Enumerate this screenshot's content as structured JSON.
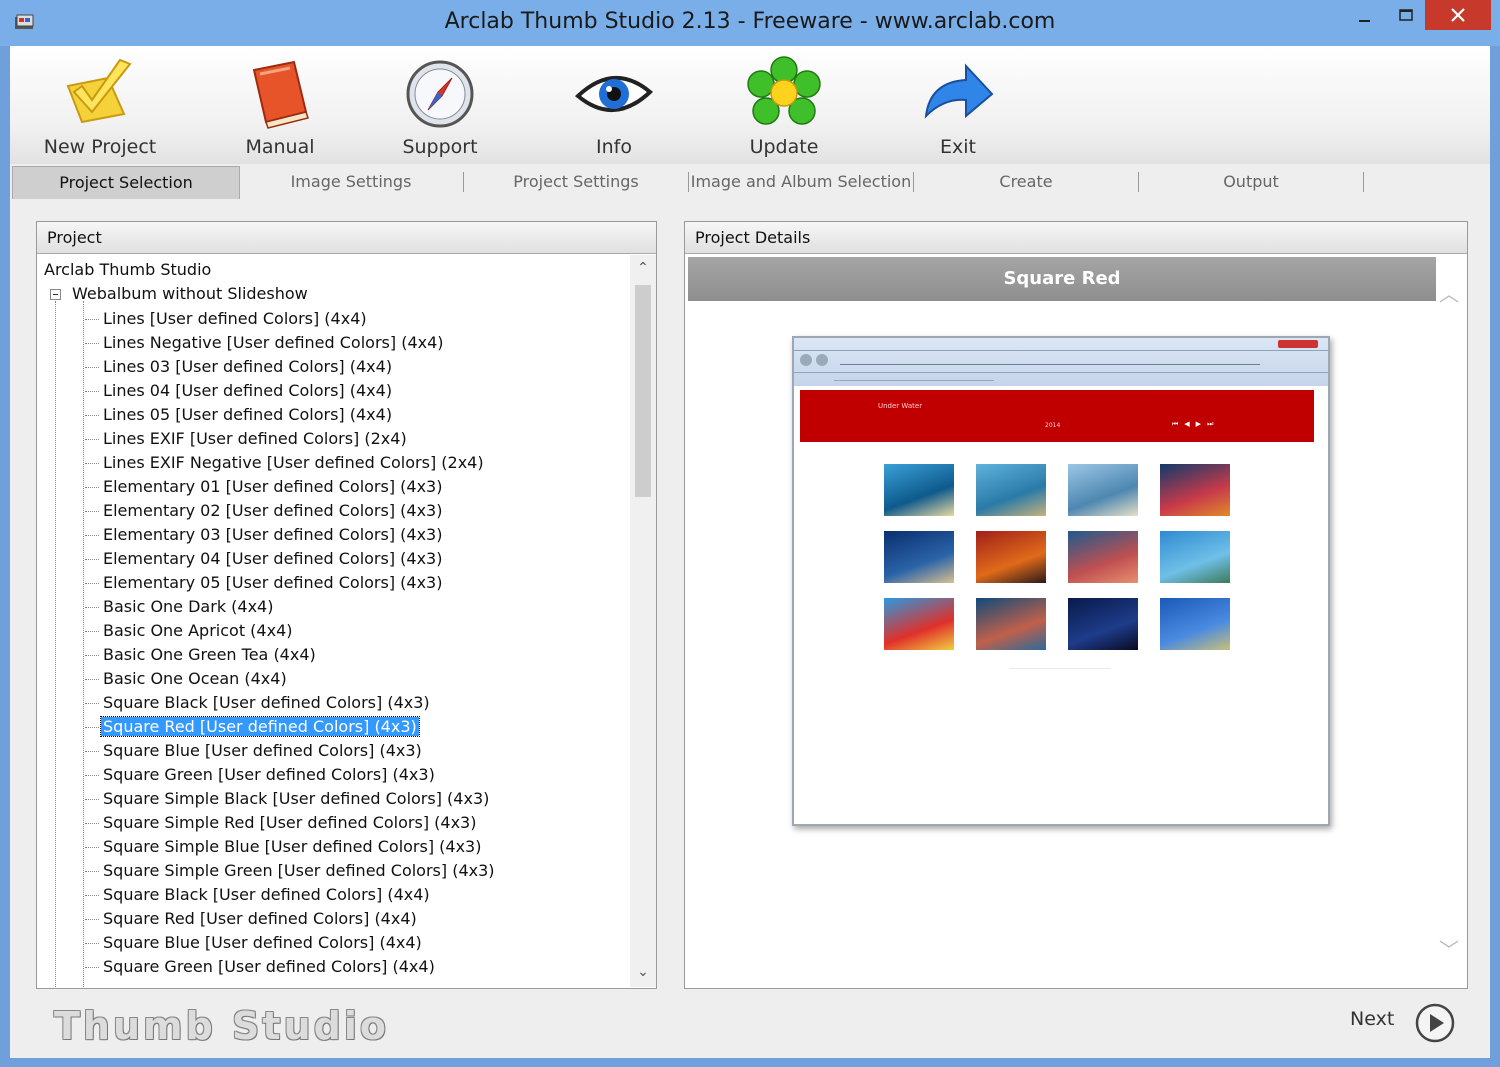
{
  "window": {
    "title": "Arclab Thumb Studio 2.13 - Freeware - www.arclab.com",
    "minimize_glyph": "—",
    "maximize_glyph": "☐",
    "close_glyph": "✕"
  },
  "toolbar": {
    "items": [
      {
        "label": "New Project",
        "icon": "new-project-icon"
      },
      {
        "label": "Manual",
        "icon": "manual-book-icon"
      },
      {
        "label": "Support",
        "icon": "compass-icon"
      },
      {
        "label": "Info",
        "icon": "eye-icon"
      },
      {
        "label": "Update",
        "icon": "flower-icon"
      },
      {
        "label": "Exit",
        "icon": "exit-arrow-icon"
      }
    ]
  },
  "tabs": [
    {
      "label": "Project Selection",
      "active": true
    },
    {
      "label": "Image Settings",
      "active": false
    },
    {
      "label": "Project Settings",
      "active": false
    },
    {
      "label": "Image and Album Selection",
      "active": false
    },
    {
      "label": "Create",
      "active": false
    },
    {
      "label": "Output",
      "active": false
    }
  ],
  "project_panel": {
    "header": "Project",
    "root": "Arclab Thumb Studio",
    "branch": "Webalbum without Slideshow",
    "items": [
      "Lines [User defined Colors] (4x4)",
      "Lines Negative [User defined Colors] (4x4)",
      "Lines 03 [User defined Colors] (4x4)",
      "Lines 04 [User defined Colors] (4x4)",
      "Lines 05 [User defined Colors] (4x4)",
      "Lines EXIF [User defined Colors] (2x4)",
      "Lines EXIF Negative [User defined Colors] (2x4)",
      "Elementary 01 [User defined Colors] (4x3)",
      "Elementary 02 [User defined Colors] (4x3)",
      "Elementary 03 [User defined Colors] (4x3)",
      "Elementary 04 [User defined Colors] (4x3)",
      "Elementary 05 [User defined Colors] (4x3)",
      "Basic One Dark (4x4)",
      "Basic One Apricot (4x4)",
      "Basic One Green Tea (4x4)",
      "Basic One Ocean (4x4)",
      "Square Black [User defined Colors] (4x3)",
      "Square Red [User defined Colors] (4x3)",
      "Square Blue [User defined Colors] (4x3)",
      "Square Green [User defined Colors] (4x3)",
      "Square Simple Black [User defined Colors] (4x3)",
      "Square Simple Red [User defined Colors] (4x3)",
      "Square Simple Blue [User defined Colors] (4x3)",
      "Square Simple Green [User defined Colors] (4x3)",
      "Square Black [User defined Colors] (4x4)",
      "Square Red [User defined Colors] (4x4)",
      "Square Blue [User defined Colors] (4x4)",
      "Square Green [User defined Colors] (4x4)"
    ],
    "selected_index": 17
  },
  "details_panel": {
    "header": "Project Details",
    "title": "Square Red",
    "preview": {
      "gallery_title": "Under Water",
      "year": "2014",
      "nav_glyphs": "⏮◀▶⏭",
      "accent": "#c00000"
    }
  },
  "footer": {
    "logo": "Thumb Studio",
    "next_label": "Next"
  },
  "colors": {
    "titlebar": "#7aaee8",
    "selection": "#3399ff",
    "close": "#c7392b"
  }
}
